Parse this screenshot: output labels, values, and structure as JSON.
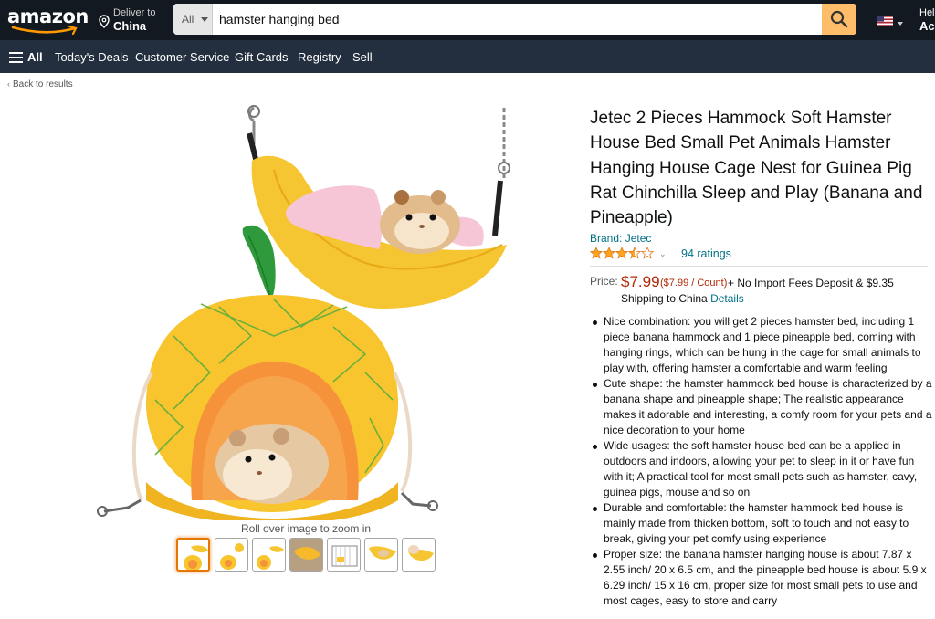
{
  "header": {
    "logo": "amazon",
    "deliver_label": "Deliver to",
    "deliver_location": "China",
    "search_category": "All",
    "search_value": "hamster hanging bed",
    "hello_line1": "Hell",
    "hello_line2": "Acc"
  },
  "nav": {
    "all_label": "All",
    "items": [
      "Today's Deals",
      "Customer Service",
      "Gift Cards",
      "Registry",
      "Sell"
    ]
  },
  "breadcrumb": {
    "back_label": "Back to results"
  },
  "gallery": {
    "zoom_hint": "Roll over image to zoom in",
    "thumbnail_count": 7,
    "selected_thumbnail": 1
  },
  "product": {
    "title": "Jetec 2 Pieces Hammock Soft Hamster House Bed Small Pet Animals Hamster Hanging House Cage Nest for Guinea Pig Rat Chinchilla Sleep and Play (Banana and Pineapple)",
    "brand": "Brand: Jetec",
    "rating_stars": 3.5,
    "rating_count": "94 ratings",
    "price_label": "Price:",
    "price": "$7.99",
    "unit_price": "($7.99 / Count)",
    "import_fees": "+ No Import Fees Deposit & $9.35",
    "shipping": "Shipping to China",
    "details_link": "Details",
    "bullets": [
      "Nice combination: you will get 2 pieces hamster bed, including 1 piece banana hammock and 1 piece pineapple bed, coming with hanging rings, which can be hung in the cage for small animals to play with, offering hamster a comfortable and warm feeling",
      "Cute shape: the hamster hammock bed house is characterized by a banana shape and pineapple shape; The realistic appearance makes it adorable and interesting, a comfy room for your pets and a nice decoration to your home",
      "Wide usages: the soft hamster house bed can be a applied in outdoors and indoors, allowing your pet to sleep in it or have fun with it; A practical tool for most small pets such as hamster, cavy, guinea pigs, mouse and so on",
      "Durable and comfortable: the hamster hammock bed house is mainly made from thicken bottom, soft to touch and not easy to break, giving your pet comfy using experience",
      "Proper size: the banana hamster hanging house is about 7.87 x 2.55 inch/ 20 x 6.5 cm, and the pineapple bed house is about 5.9 x 6.29 inch/ 15 x 16 cm, proper size for most small pets to use and most cages, easy to store and carry"
    ]
  },
  "colors": {
    "header_bg": "#131921",
    "nav_bg": "#232f3e",
    "search_button": "#febd69",
    "price": "#b12704",
    "link": "#007185",
    "star": "#ffa41c"
  }
}
